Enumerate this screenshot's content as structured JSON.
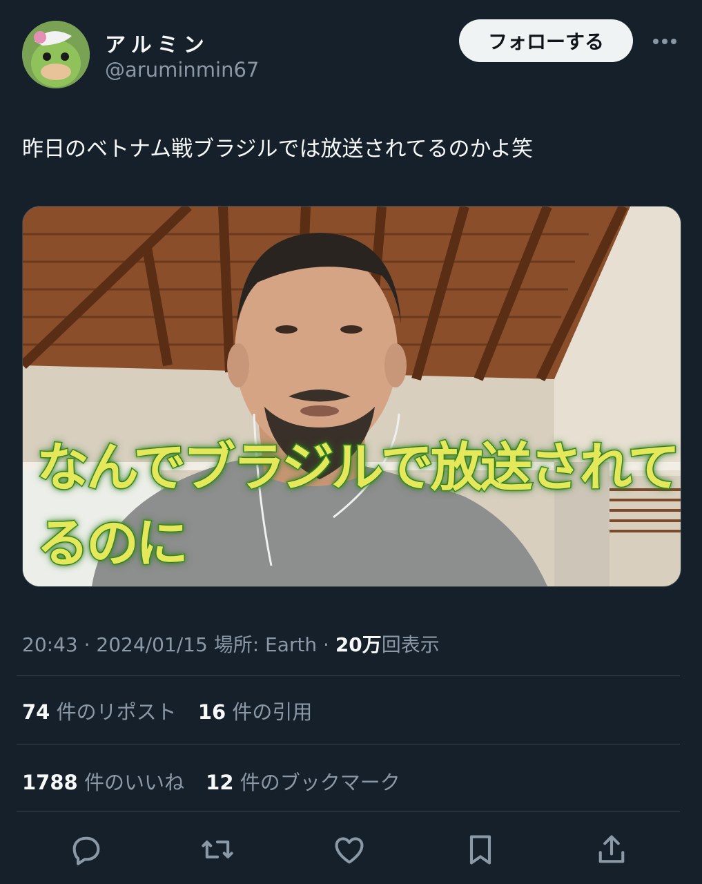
{
  "author": {
    "display_name": "アルミン",
    "handle": "@aruminmin67"
  },
  "follow_label": "フォローする",
  "tweet": {
    "text": "昨日のベトナム戦ブラジルでは放送されてるのかよ笑",
    "media_caption": "なんでブラジルで放送されてるのに"
  },
  "meta": {
    "time": "20:43",
    "sep1": " · ",
    "date": "2024/01/15",
    "location": " 場所: Earth",
    "sep2": " · ",
    "views_count": "20万",
    "views_label": "回表示"
  },
  "stats": {
    "reposts_count": "74",
    "reposts_label": "件のリポスト",
    "quotes_count": "16",
    "quotes_label": "件の引用",
    "likes_count": "1788",
    "likes_label": "件のいいね",
    "bookmarks_count": "12",
    "bookmarks_label": "件のブックマーク"
  },
  "icons": [
    "more-icon",
    "reply-icon",
    "retweet-icon",
    "like-icon",
    "bookmark-icon",
    "share-icon"
  ],
  "colors": {
    "background": "#15202b",
    "secondary_text": "#8b98a5",
    "divider": "#38444d",
    "caption_fill": "#e5e85a",
    "caption_stroke": "#3f9a2a"
  }
}
